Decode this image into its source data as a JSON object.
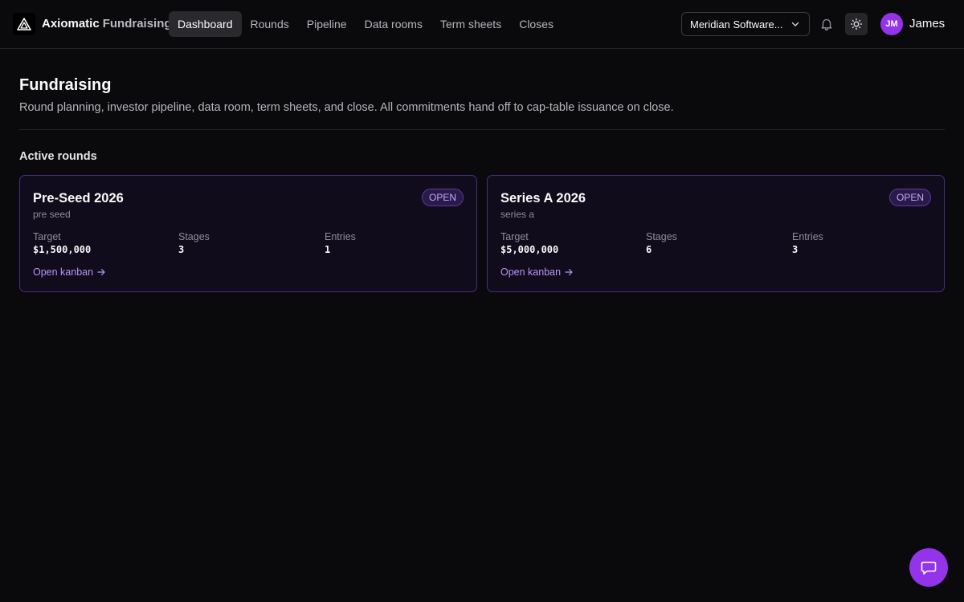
{
  "header": {
    "brand_primary": "Axiomatic",
    "brand_secondary": "Fundraising",
    "nav": [
      {
        "label": "Dashboard",
        "active": true
      },
      {
        "label": "Rounds"
      },
      {
        "label": "Pipeline"
      },
      {
        "label": "Data rooms"
      },
      {
        "label": "Term sheets"
      },
      {
        "label": "Closes"
      }
    ],
    "org_select": "Meridian Software...",
    "avatar_initials": "JM",
    "user_name": "James"
  },
  "page": {
    "title": "Fundraising",
    "subtitle": "Round planning, investor pipeline, data room, term sheets, and close. All commitments hand off to cap-table issuance on close.",
    "section_title": "Active rounds"
  },
  "rounds": [
    {
      "title": "Pre-Seed 2026",
      "subtitle": "pre seed",
      "status": "OPEN",
      "target_label": "Target",
      "target": "$1,500,000",
      "stages_label": "Stages",
      "stages": "3",
      "entries_label": "Entries",
      "entries": "1",
      "link": "Open kanban"
    },
    {
      "title": "Series A 2026",
      "subtitle": "series a",
      "status": "OPEN",
      "target_label": "Target",
      "target": "$5,000,000",
      "stages_label": "Stages",
      "stages": "6",
      "entries_label": "Entries",
      "entries": "3",
      "link": "Open kanban"
    }
  ],
  "icons": {
    "logo": "axiomatic-logo-icon",
    "chevron": "chevron-down-icon",
    "bell": "bell-icon",
    "theme": "sun-icon",
    "arrow": "arrow-right-icon",
    "chat": "chat-icon"
  },
  "colors": {
    "accent": "#9333ea",
    "link": "#b794f6",
    "card_border": "#4b2a8a",
    "background": "#0a0a0c"
  }
}
